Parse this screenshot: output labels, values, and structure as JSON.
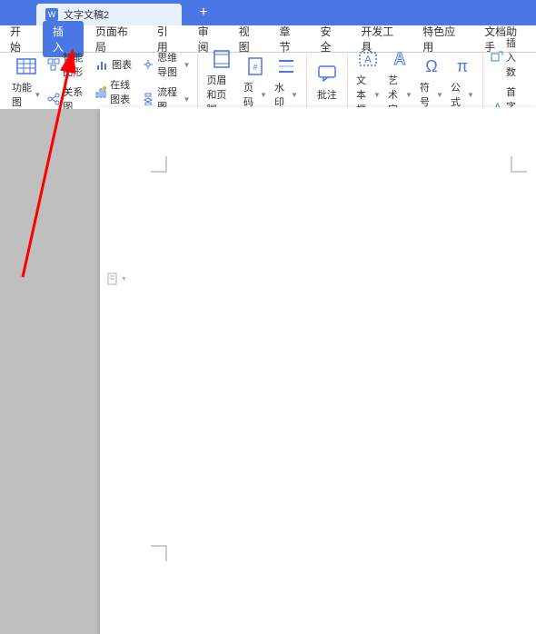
{
  "tab": {
    "title": "文字文稿2"
  },
  "menu": {
    "items": [
      "开始",
      "插入",
      "页面布局",
      "引用",
      "审阅",
      "视图",
      "章节",
      "安全",
      "开发工具",
      "特色应用",
      "文档助手"
    ],
    "active_index": 1
  },
  "ribbon": {
    "group1": {
      "btn1": "功能图",
      "btn2a": "智能图形",
      "btn2b": "关系图",
      "btn3a": "图表",
      "btn3b": "在线图表",
      "btn4a": "思维导图",
      "btn4b": "流程图"
    },
    "group2": {
      "btn1": "页眉和页脚",
      "btn2": "页码",
      "btn3": "水印"
    },
    "group3": {
      "btn1": "批注"
    },
    "group4": {
      "btn1": "文本框",
      "btn2": "艺术字",
      "btn3": "符号",
      "btn4": "公式"
    },
    "group5": {
      "btn1": "插入数",
      "btn2": "首字下"
    }
  }
}
